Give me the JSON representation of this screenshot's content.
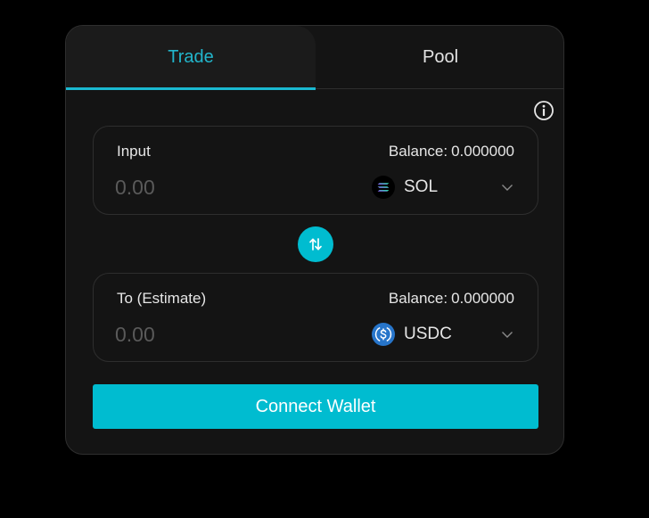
{
  "tabs": {
    "trade": "Trade",
    "pool": "Pool",
    "active": "trade"
  },
  "info": {
    "icon": "info-circle-icon"
  },
  "input": {
    "label": "Input",
    "balance_label": "Balance:",
    "balance_value": "0.000000",
    "amount_value": "",
    "amount_placeholder": "0.00",
    "token": {
      "symbol": "SOL",
      "icon": "solana-icon"
    }
  },
  "swap": {
    "icon": "swap-arrows-icon"
  },
  "output": {
    "label": "To (Estimate)",
    "balance_label": "Balance:",
    "balance_value": "0.000000",
    "amount_value": "",
    "amount_placeholder": "0.00",
    "token": {
      "symbol": "USDC",
      "icon": "usdc-icon"
    }
  },
  "connect_button": {
    "label": "Connect Wallet"
  },
  "colors": {
    "accent": "#00bcd0",
    "background": "#000000",
    "card": "#141414",
    "border": "#2e2e2e"
  }
}
